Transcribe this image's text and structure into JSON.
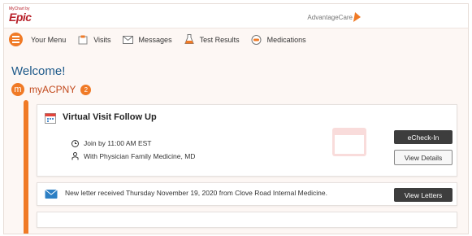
{
  "brand": {
    "small_text": "MyChart by",
    "logo_text": "Epic"
  },
  "partner": {
    "name": "AdvantageCare"
  },
  "menubar": {
    "items": [
      {
        "label": "Your Menu",
        "icon": "hamburger-icon"
      },
      {
        "label": "Visits",
        "icon": "clipboard-icon"
      },
      {
        "label": "Messages",
        "icon": "envelope-icon"
      },
      {
        "label": "Test Results",
        "icon": "flask-icon"
      },
      {
        "label": "Medications",
        "icon": "pill-icon"
      }
    ]
  },
  "welcome": {
    "title": "Welcome!"
  },
  "org": {
    "avatar_letter": "m",
    "name": "myACPNY",
    "count": "2"
  },
  "visit_card": {
    "title": "Virtual Visit Follow Up",
    "join_text": "Join by 11:00 AM EST",
    "provider_text": "With Physician Family Medicine, MD",
    "checkin_label": "eCheck-In",
    "details_label": "View Details"
  },
  "letter_card": {
    "text": "New letter received Thursday November 19, 2020 from Clove Road Internal Medicine.",
    "button_label": "View Letters"
  },
  "colors": {
    "accent": "#f07a26",
    "brand_red": "#b8222b",
    "welcome_blue": "#1e5a8a"
  }
}
